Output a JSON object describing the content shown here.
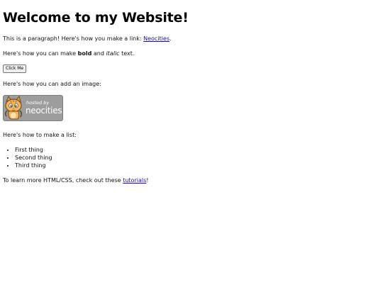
{
  "heading": "Welcome to my Website!",
  "paragraph": {
    "text_before": "This is a paragraph! Here's how you make a link: ",
    "link_label": "Neocities",
    "text_after": "."
  },
  "formatting": {
    "text_before": "Here's how you can make ",
    "bold": "bold",
    "text_middle": " and ",
    "italic": "italic",
    "text_after": " text."
  },
  "button_label": "Click Me",
  "image_intro": "Here's how you can add an image:",
  "badge": {
    "small_text": "hosted by",
    "brand": "neocities",
    "alt": "Site hosted by Neocities"
  },
  "list_intro": "Here's how to make a list:",
  "list_items": [
    "First thing",
    "Second thing",
    "Third thing"
  ],
  "footer": {
    "text_before": "To learn more HTML/CSS, check out these ",
    "link_label": "tutorials",
    "text_after": "!"
  },
  "colors": {
    "link": "#1a0dab",
    "badge_bg": "#9d9d9d",
    "cat_orange": "#e89a3a"
  }
}
